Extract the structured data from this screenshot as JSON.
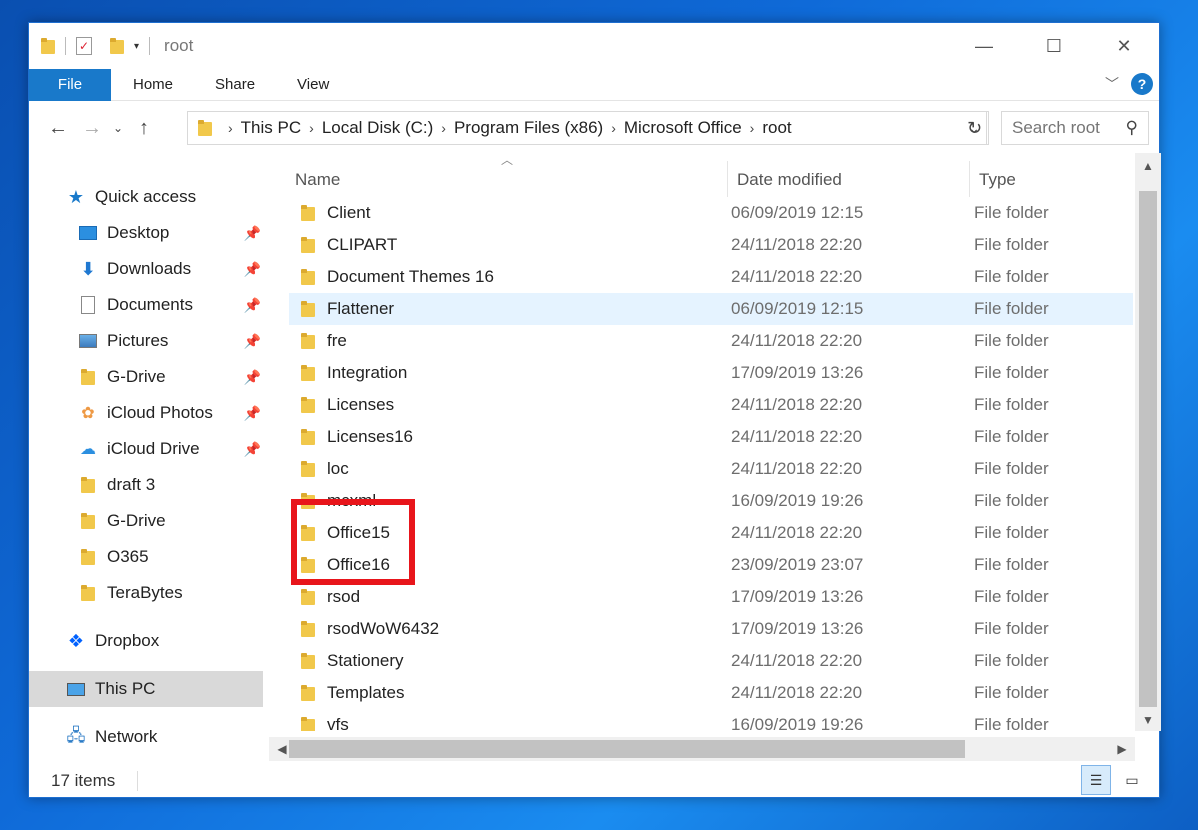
{
  "window": {
    "title": "root",
    "controls": {
      "minimize": "—",
      "maximize": "☐",
      "close": "✕"
    }
  },
  "ribbon": {
    "tabs": [
      "File",
      "Home",
      "Share",
      "View"
    ],
    "help": "?"
  },
  "nav": {
    "breadcrumbs": [
      "This PC",
      "Local Disk (C:)",
      "Program Files (x86)",
      "Microsoft Office",
      "root"
    ],
    "search_placeholder": "Search root"
  },
  "sidebar": {
    "items": [
      {
        "label": "Quick access",
        "icon": "star-icon",
        "pinned": false
      },
      {
        "label": "Desktop",
        "icon": "desktop-icon",
        "pinned": true
      },
      {
        "label": "Downloads",
        "icon": "download-icon",
        "pinned": true
      },
      {
        "label": "Documents",
        "icon": "documents-icon",
        "pinned": true
      },
      {
        "label": "Pictures",
        "icon": "pictures-icon",
        "pinned": true
      },
      {
        "label": "G-Drive",
        "icon": "folder-icon",
        "pinned": true
      },
      {
        "label": "iCloud Photos",
        "icon": "icloud-photos-icon",
        "pinned": true
      },
      {
        "label": "iCloud Drive",
        "icon": "icloud-drive-icon",
        "pinned": true
      },
      {
        "label": "draft 3",
        "icon": "folder-sync-icon",
        "pinned": false
      },
      {
        "label": "G-Drive",
        "icon": "folder-sync-icon",
        "pinned": false
      },
      {
        "label": "O365",
        "icon": "folder-icon",
        "pinned": false
      },
      {
        "label": "TeraBytes",
        "icon": "folder-icon",
        "pinned": false
      },
      {
        "label": "Dropbox",
        "icon": "dropbox-icon",
        "pinned": false
      },
      {
        "label": "This PC",
        "icon": "pc-icon",
        "pinned": false
      },
      {
        "label": "Network",
        "icon": "network-icon",
        "pinned": false
      }
    ]
  },
  "filelist": {
    "columns": [
      "Name",
      "Date modified",
      "Type"
    ],
    "rows": [
      {
        "name": "Client",
        "date": "06/09/2019 12:15",
        "type": "File folder"
      },
      {
        "name": "CLIPART",
        "date": "24/11/2018 22:20",
        "type": "File folder"
      },
      {
        "name": "Document Themes 16",
        "date": "24/11/2018 22:20",
        "type": "File folder"
      },
      {
        "name": "Flattener",
        "date": "06/09/2019 12:15",
        "type": "File folder"
      },
      {
        "name": "fre",
        "date": "24/11/2018 22:20",
        "type": "File folder"
      },
      {
        "name": "Integration",
        "date": "17/09/2019 13:26",
        "type": "File folder"
      },
      {
        "name": "Licenses",
        "date": "24/11/2018 22:20",
        "type": "File folder"
      },
      {
        "name": "Licenses16",
        "date": "24/11/2018 22:20",
        "type": "File folder"
      },
      {
        "name": "loc",
        "date": "24/11/2018 22:20",
        "type": "File folder"
      },
      {
        "name": "mcxml",
        "date": "16/09/2019 19:26",
        "type": "File folder"
      },
      {
        "name": "Office15",
        "date": "24/11/2018 22:20",
        "type": "File folder"
      },
      {
        "name": "Office16",
        "date": "23/09/2019 23:07",
        "type": "File folder"
      },
      {
        "name": "rsod",
        "date": "17/09/2019 13:26",
        "type": "File folder"
      },
      {
        "name": "rsodWoW6432",
        "date": "17/09/2019 13:26",
        "type": "File folder"
      },
      {
        "name": "Stationery",
        "date": "24/11/2018 22:20",
        "type": "File folder"
      },
      {
        "name": "Templates",
        "date": "24/11/2018 22:20",
        "type": "File folder"
      },
      {
        "name": "vfs",
        "date": "16/09/2019 19:26",
        "type": "File folder"
      }
    ]
  },
  "status": {
    "item_count": "17 items"
  },
  "colors": {
    "accent": "#1979ca",
    "hover_row": "#e5f3ff",
    "highlight": "#e8151b",
    "selected_nav": "#d9d9d9"
  }
}
